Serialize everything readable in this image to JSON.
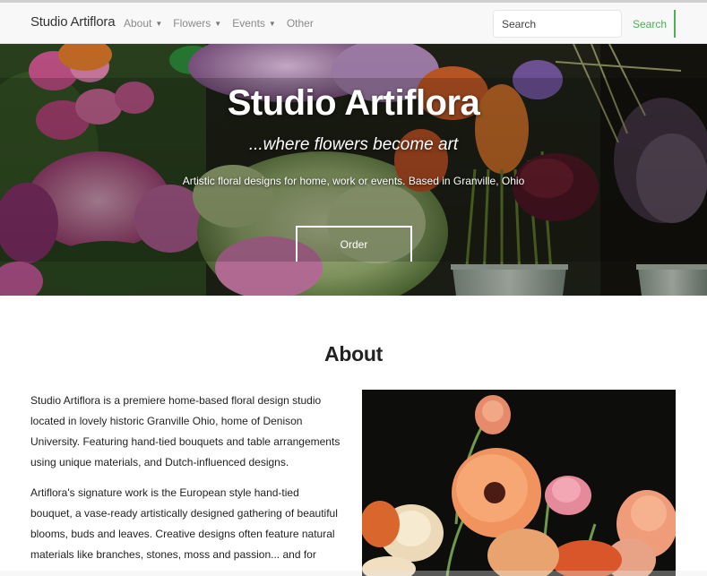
{
  "navbar": {
    "brand": "Studio Artiflora",
    "menu": [
      {
        "label": "About",
        "has_dropdown": true
      },
      {
        "label": "Flowers",
        "has_dropdown": true
      },
      {
        "label": "Events",
        "has_dropdown": true
      },
      {
        "label": "Other",
        "has_dropdown": false
      }
    ],
    "search_placeholder": "Search",
    "search_button": "Search",
    "accent_color": "#4caf50"
  },
  "hero": {
    "title": "Studio Artiflora",
    "tagline": "...where flowers become art",
    "description": "Artistic floral designs for home, work or events. Based in Granville, Ohio",
    "order_button": "Order"
  },
  "about": {
    "heading": "About",
    "paragraphs": [
      "Studio Artiflora is a premiere home-based floral design studio located in lovely historic Granville Ohio, home of Denison University. Featuring hand-tied bouquets and table arrangements using unique materials, and Dutch-influenced designs.",
      "Artiflora's signature work is the European style hand-tied bouquet, a vase-ready artistically designed gathering of beautiful blooms, buds and leaves. Creative designs often feature natural materials like branches, stones, moss and passion... and for"
    ]
  }
}
